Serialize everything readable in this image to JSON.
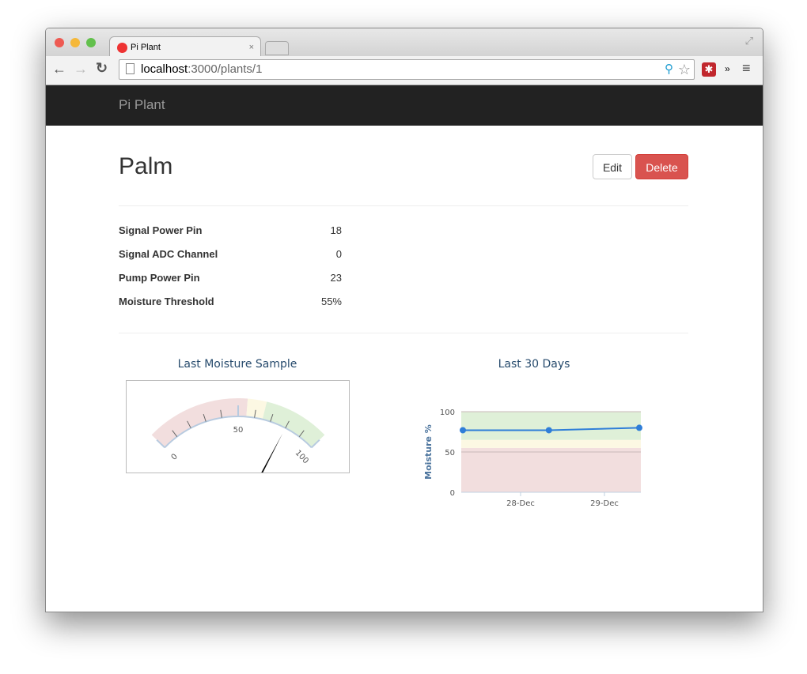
{
  "browser": {
    "tab_title": "Pi Plant",
    "url_host": "localhost",
    "url_path": ":3000/plants/1"
  },
  "navbar": {
    "brand": "Pi Plant"
  },
  "plant": {
    "name": "Palm",
    "edit_label": "Edit",
    "delete_label": "Delete",
    "details": [
      {
        "label": "Signal Power Pin",
        "value": "18"
      },
      {
        "label": "Signal ADC Channel",
        "value": "0"
      },
      {
        "label": "Pump Power Pin",
        "value": "23"
      },
      {
        "label": "Moisture Threshold",
        "value": "55%"
      }
    ]
  },
  "colors": {
    "danger": "#d9534f",
    "red_band": "#f2dede",
    "yellow_band": "#fcf8e3",
    "green_band": "#dff0d8",
    "series": "#2f7ed8"
  },
  "chart_data": [
    {
      "type": "gauge",
      "title": "Last Moisture Sample",
      "min": 0,
      "max": 100,
      "value": 80,
      "tick_labels": [
        "0",
        "50",
        "100"
      ],
      "bands": [
        {
          "from": 0,
          "to": 55,
          "color": "red"
        },
        {
          "from": 55,
          "to": 65,
          "color": "yellow"
        },
        {
          "from": 65,
          "to": 100,
          "color": "green"
        }
      ]
    },
    {
      "type": "line",
      "title": "Last 30 Days",
      "ylabel": "Moisture %",
      "ylim": [
        0,
        100
      ],
      "yticks": [
        "0",
        "50",
        "100"
      ],
      "xticks": [
        "28-Dec",
        "29-Dec"
      ],
      "x": [
        0,
        1,
        2.05
      ],
      "values": [
        77,
        77,
        80
      ],
      "bands": [
        {
          "from": 0,
          "to": 55,
          "color": "red"
        },
        {
          "from": 55,
          "to": 65,
          "color": "yellow"
        },
        {
          "from": 65,
          "to": 100,
          "color": "green"
        }
      ]
    }
  ]
}
